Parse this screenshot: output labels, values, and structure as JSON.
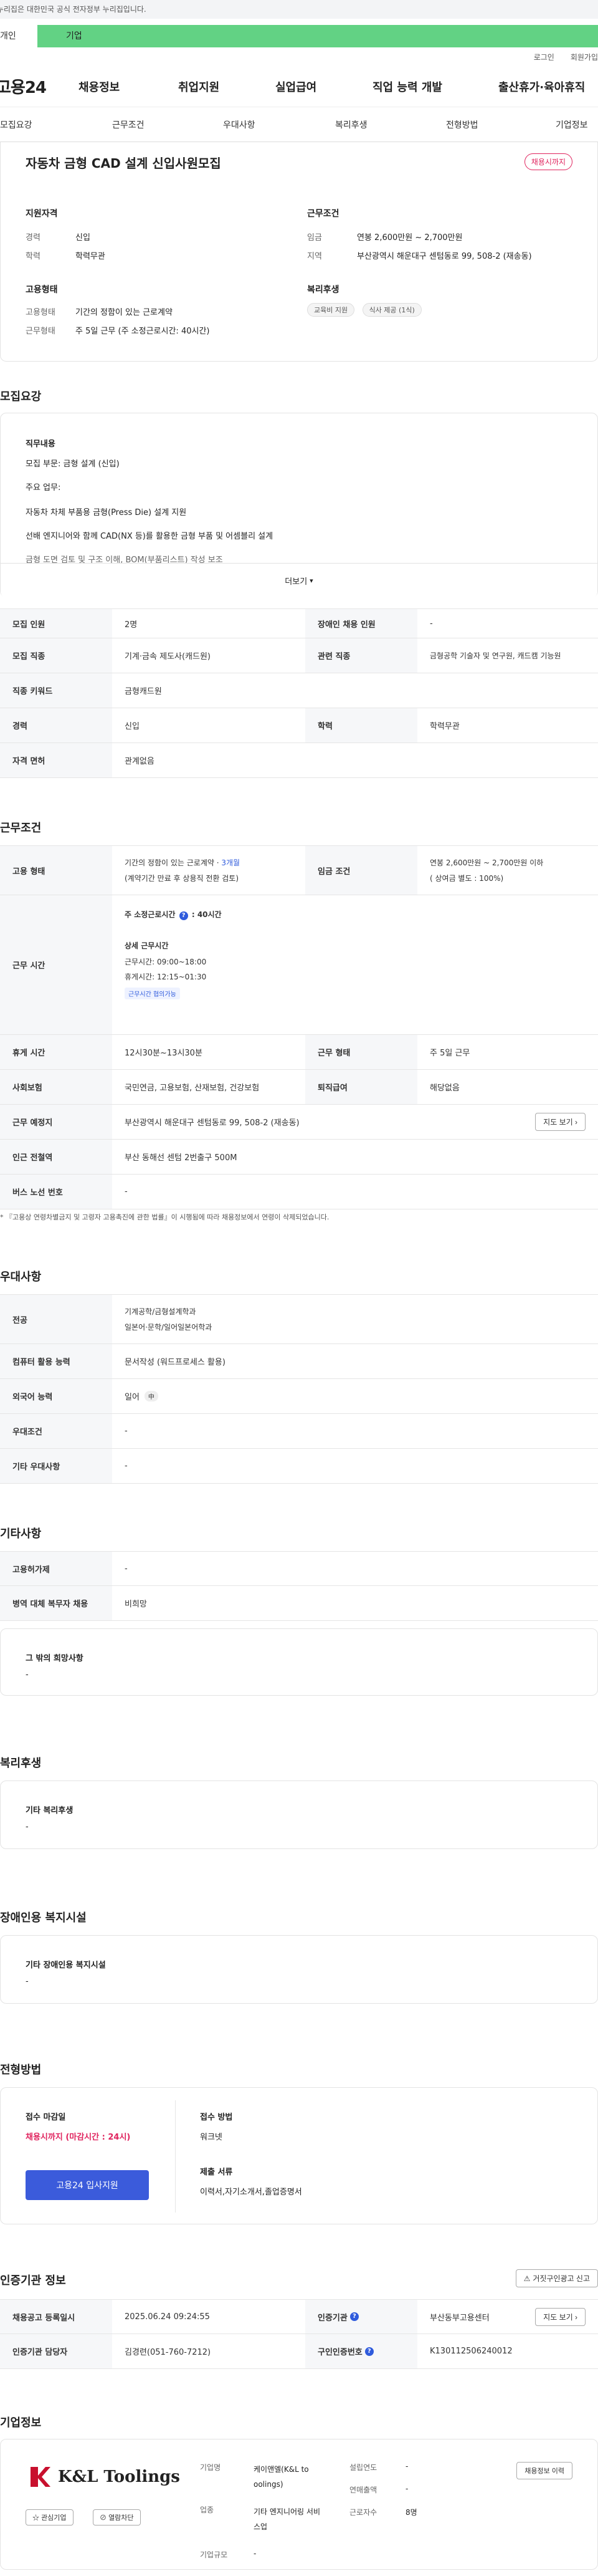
{
  "gov_banner": "이 누리집은 대한민국 공식 전자정부 누리집입니다.",
  "top_tabs": [
    "개인",
    "기업"
  ],
  "util_links": [
    "로그인",
    "회원가입"
  ],
  "logo": "고용24",
  "gnb": [
    "채용정보",
    "취업지원",
    "실업급여",
    "직업 능력 개발",
    "출산휴가·육아휴직"
  ],
  "subnav": [
    "모집요강",
    "근무조건",
    "우대사항",
    "복리후생",
    "전형방법",
    "기업정보"
  ],
  "job": {
    "title": "자동차 금형 CAD 설계 신입사원모집",
    "status_badge": "채용시까지",
    "apply_qual_title": "지원자격",
    "career_label": "경력",
    "career_value": "신입",
    "edu_label": "학력",
    "edu_value": "학력무관",
    "work_cond_title": "근무조건",
    "wage_label": "임금",
    "wage_value": "연봉 2,600만원 ~ 2,700만원",
    "region_label": "지역",
    "region_value": "부산광역시 해운대구 센텀동로 99, 508-2 (재송동)",
    "emp_type_title": "고용형태",
    "emp_label": "고용형태",
    "emp_value": "기간의 정함이 있는 근로계약",
    "work_form_label": "근무형태",
    "work_form_value": "주 5일 근무 (주 소정근로시간: 40시간)",
    "welfare_title": "복리후생",
    "welfare_chips": [
      "교육비 지원",
      "식사 제공 (1식)"
    ]
  },
  "recruit": {
    "title": "모집요강",
    "duty_title": "직무내용",
    "duty_lines": [
      "모집 부문: 금형 설계 (신입)",
      "주요 업무:",
      "자동차 차체 부품용 금형(Press Die) 설계 지원",
      "선배 엔지니어와 함께 CAD(NX 등)를 활용한 금형 부품 및 어셈블리 설계",
      "금형 도면 검토 및 구조 이해, BOM(부품리스트) 작성 보조"
    ],
    "more_label": "더보기",
    "rows": [
      {
        "h1": "모집 인원",
        "v1": "2명",
        "h2": "장애인 채용 인원",
        "v2": "-"
      },
      {
        "h1": "모집 직종",
        "v1": "기계·금속 제도사(캐드원)",
        "h2": "관련 직종",
        "v2": "금형공학 기술자 및 연구원, 캐드캠 기능원"
      },
      {
        "h1": "직종 키워드",
        "v1": "금형캐드원",
        "h2": "",
        "v2": ""
      },
      {
        "h1": "경력",
        "v1": "신입",
        "h2": "학력",
        "v2": "학력무관"
      },
      {
        "h1": "자격 면허",
        "v1": "관계없음",
        "h2": "",
        "v2": ""
      }
    ]
  },
  "conditions": {
    "title": "근무조건",
    "emp_type_h": "고용 형태",
    "emp_type_v1": "기간의 정함이 있는 근로계약 · ",
    "emp_type_months": "3개월",
    "emp_type_v2": "(계약기간 만료 후 상용직 전환 검토)",
    "wage_h": "임금 조건",
    "wage_v1": "연봉 2,600만원 ~ 2,700만원 이하",
    "wage_v2": "( 상여금 별도 : 100%)",
    "hours_h": "근무 시간",
    "hours_weekly": "주 소정근로시간",
    "hours_weekly_val": ": 40시간",
    "hours_detail_title": "상세 근무시간",
    "hours_work": "근무시간: 09:00~18:00",
    "hours_break": "휴게시간: 12:15~01:30",
    "hours_tag": "근무시간 협의가능",
    "rows": [
      {
        "h1": "휴게 시간",
        "v1": "12시30분~13시30분",
        "h2": "근무 형태",
        "v2": "주 5일 근무"
      },
      {
        "h1": "사회보험",
        "v1": "국민연금, 고용보험, 산재보험, 건강보험",
        "h2": "퇴직급여",
        "v2": "해당없음"
      }
    ],
    "place_h": "근무 예정지",
    "place_v": "부산광역시 해운대구 센텀동로 99, 508-2 (재송동)",
    "map_btn": "지도 보기",
    "station_h": "인근 전철역",
    "station_v": "부산 동해선 센텀 2번출구 500M",
    "bus_h": "버스 노선 번호",
    "bus_v": "-",
    "note": "* 『고용상 연령차별금지 및 고령자 고용촉진에 관한 법률』이 시행됨에 따라 채용정보에서 연령이 삭제되었습니다."
  },
  "prefer": {
    "title": "우대사항",
    "major_h": "전공",
    "major_v1": "기계공학/금형설계학과",
    "major_v2": "일본어·문학/일어일본어학과",
    "pc_h": "컴퓨터 활용 능력",
    "pc_v": "문서작성 (워드프로세스 활용)",
    "lang_h": "외국어 능력",
    "lang_v": "일어",
    "lang_tag": "中",
    "cond_h": "우대조건",
    "cond_v": "-",
    "etc_h": "기타 우대사항",
    "etc_v": "-"
  },
  "others": {
    "title": "기타사항",
    "rows": [
      {
        "h": "고용허가제",
        "v": "-"
      },
      {
        "h": "병역 대체 복무자 채용",
        "v": "비희망"
      }
    ],
    "extra_title": "그 밖의 희망사항",
    "extra_v": "-"
  },
  "welfare": {
    "title": "복리후생",
    "box_title": "기타 복리후생",
    "box_v": "-"
  },
  "disabled": {
    "title": "장애인용 복지시설",
    "box_title": "기타 장애인용 복지시설",
    "box_v": "-"
  },
  "screening": {
    "title": "전형방법",
    "deadline_title": "접수 마감일",
    "deadline_v": "채용시까지 (마감시간 : 24시)",
    "apply_btn": "고용24 입사지원",
    "method_title": "접수 방법",
    "method_v": "워크넷",
    "docs_title": "제출 서류",
    "docs_v": "이력서,자기소개서,졸업증명서"
  },
  "agency": {
    "title": "인증기관 정보",
    "report_btn": "거짓구인광고 신고",
    "reg_h": "채용공고 등록일시",
    "reg_v": "2025.06.24 09:24:55",
    "org_h": "인증기관",
    "org_v": "부산동부고용센터",
    "map_btn": "지도 보기",
    "mgr_h": "인증기관 담당자",
    "mgr_v": "김경련(051-760-7212)",
    "no_h": "구인인증번호",
    "no_v": "K130112506240012"
  },
  "company": {
    "title": "기업정보",
    "logo_text": "K&L Toolings",
    "fav_btn": "관심기업",
    "follow_btn": "열람차단",
    "name_h": "기업명",
    "name_v": "케이앤엘(K&L to oolings)",
    "industry_h": "업종",
    "industry_v": "기타 엔지니어링 서비스업",
    "size_h": "기업규모",
    "size_v": "-",
    "year_h": "설립연도",
    "year_v": "-",
    "sales_h": "연매출액",
    "sales_v": "-",
    "emp_h": "근로자수",
    "emp_v": "8명",
    "jobs_btn": "채용정보 이력"
  }
}
